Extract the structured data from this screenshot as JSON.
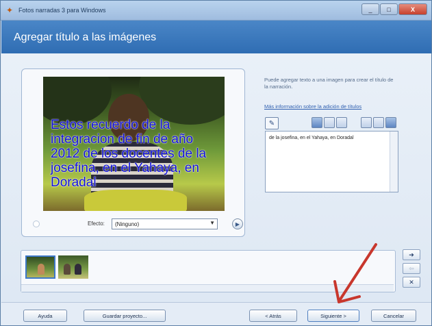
{
  "window": {
    "title": "Fotos narradas 3 para Windows",
    "controls": {
      "minimize": "_",
      "maximize": "□",
      "close": "X"
    }
  },
  "header": {
    "title": "Agregar título a las imágenes"
  },
  "preview": {
    "caption": "Estos recuerdo de la integracion de fin de año 2012 de los docentes de la josefina, en el Yahaya, en Doradal",
    "effect_label": "Efecto:",
    "effect_value": "(Ninguno)"
  },
  "side_panel": {
    "info_text": "Puede agregar texto a una imagen para crear el título de la narración.",
    "more_link": "Más información sobre la adición de títulos",
    "text_value": "de la josefina, en el Yahaya, en Doradal"
  },
  "filmstrip": {
    "thumbnails": [
      "foto-1",
      "foto-2"
    ]
  },
  "buttons": {
    "help": "Ayuda",
    "save_project": "Guardar proyecto...",
    "back": "< Atrás",
    "next": "Siguiente >",
    "cancel": "Cancelar"
  },
  "colors": {
    "header": "#3a78be",
    "caption": "#1010d8",
    "arrow": "#c8372d"
  },
  "icons": [
    "app-icon",
    "edit-icon",
    "play-icon",
    "arrow-right-icon",
    "arrow-left-icon",
    "delete-icon"
  ]
}
